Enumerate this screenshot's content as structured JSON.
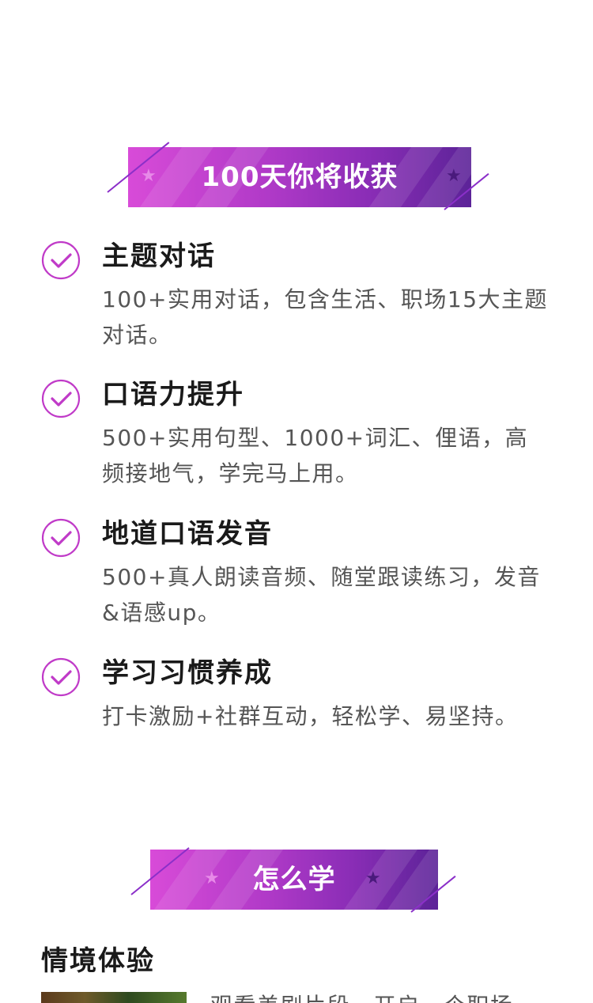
{
  "colors": {
    "accent": "#c03ac8",
    "banner_start": "#d84bd8",
    "banner_end": "#5c2398",
    "heading": "#1a1a1a",
    "body_text": "#555555"
  },
  "banners": [
    {
      "title": "100天你将收获",
      "icons": [
        "star-icon",
        "star-icon"
      ]
    },
    {
      "title": "怎么学",
      "icons": [
        "star-icon",
        "star-icon"
      ]
    }
  ],
  "benefits": [
    {
      "icon": "check-circle-icon",
      "heading": "主题对话",
      "desc": "100+实用对话，包含生活、职场15大主题对话。"
    },
    {
      "icon": "check-circle-icon",
      "heading": "口语力提升",
      "desc": "500+实用句型、1000+词汇、俚语，高频接地气，学完马上用。"
    },
    {
      "icon": "check-circle-icon",
      "heading": "地道口语发音",
      "desc": "500+真人朗读音频、随堂跟读练习，发音&语感up。"
    },
    {
      "icon": "check-circle-icon",
      "heading": "学习习惯养成",
      "desc": "打卡激励+社群互动，轻松学、易坚持。"
    }
  ],
  "how_to_learn": {
    "section_heading": "情境体验",
    "partial_text": "观看美剧片段，开启一个职场"
  }
}
